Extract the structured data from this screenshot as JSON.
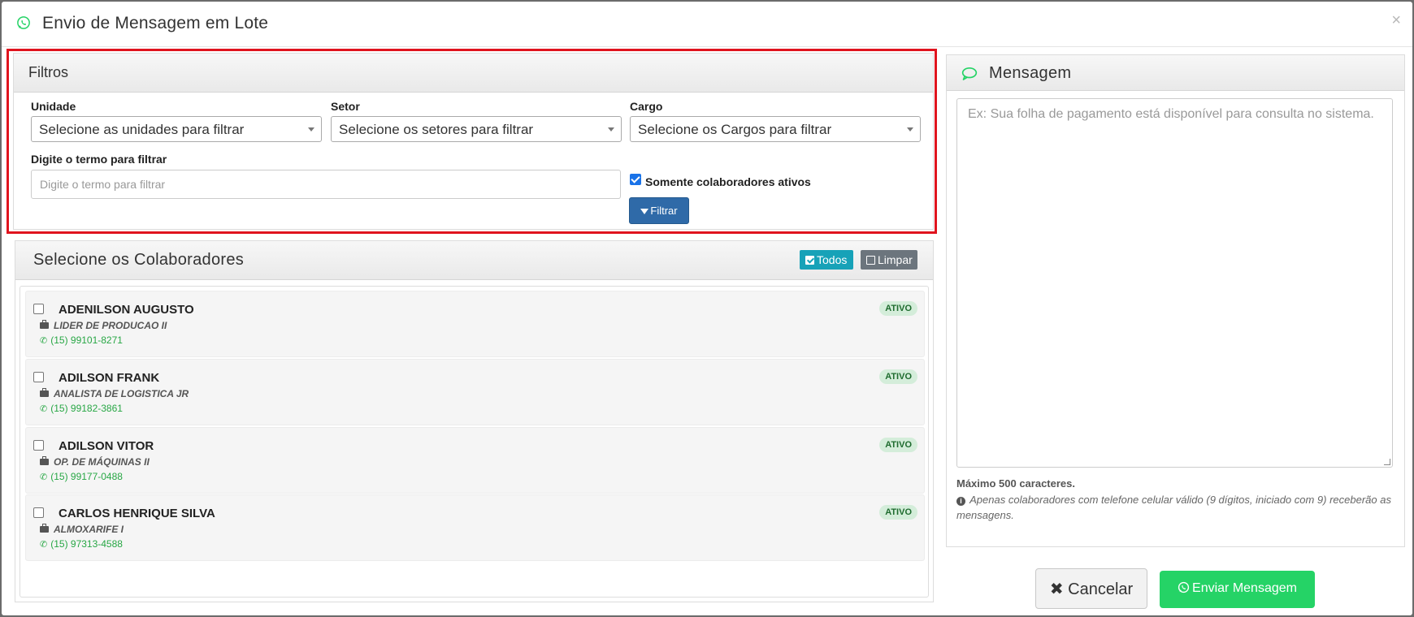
{
  "modal": {
    "title": "Envio de Mensagem em Lote",
    "close_label": "×"
  },
  "filters": {
    "title": "Filtros",
    "unidade_label": "Unidade",
    "unidade_placeholder": "Selecione as unidades para filtrar",
    "setor_label": "Setor",
    "setor_placeholder": "Selecione os setores para filtrar",
    "cargo_label": "Cargo",
    "cargo_placeholder": "Selecione os Cargos para filtrar",
    "term_label": "Digite o termo para filtrar",
    "term_placeholder": "Digite o termo para filtrar",
    "term_value": "",
    "only_active_label": "Somente colaboradores ativos",
    "only_active_checked": true,
    "filter_button": "Filtrar"
  },
  "colaboradores": {
    "title": "Selecione os Colaboradores",
    "select_all_label": "Todos",
    "clear_label": "Limpar",
    "items": [
      {
        "name": "ADENILSON AUGUSTO",
        "role": "LIDER DE PRODUCAO II",
        "phone": "(15) 99101-8271",
        "status": "ATIVO",
        "checked": false
      },
      {
        "name": "ADILSON FRANK",
        "role": "ANALISTA DE LOGISTICA JR",
        "phone": "(15) 99182-3861",
        "status": "ATIVO",
        "checked": false
      },
      {
        "name": "ADILSON VITOR",
        "role": "OP. DE MÁQUINAS II",
        "phone": "(15) 99177-0488",
        "status": "ATIVO",
        "checked": false
      },
      {
        "name": "CARLOS HENRIQUE SILVA",
        "role": "ALMOXARIFE I",
        "phone": "(15) 97313-4588",
        "status": "ATIVO",
        "checked": false
      }
    ]
  },
  "message": {
    "title": "Mensagem",
    "placeholder": "Ex: Sua folha de pagamento está disponível para consulta no sistema.",
    "value": "",
    "max_chars_note": "Máximo 500 caracteres.",
    "info_note": "Apenas colaboradores com telefone celular válido (9 dígitos, iniciado com 9) receberão as mensagens."
  },
  "footer": {
    "cancel_label": "Cancelar",
    "send_label": "Enviar Mensagem"
  },
  "colors": {
    "whatsapp_green": "#25d366",
    "filter_button": "#2f6aa8",
    "todos_button": "#17a2b8",
    "limpar_button": "#6c757d",
    "highlight_border": "#e0141e",
    "badge_bg": "#d4edda",
    "phone_text": "#28a745"
  },
  "icons": {
    "header": "whatsapp-icon",
    "close": "close-icon",
    "filter": "filter-icon",
    "message": "chat-bubble-icon",
    "role": "briefcase-icon",
    "phone": "phone-icon",
    "info": "info-icon",
    "cancel": "times-icon",
    "send": "whatsapp-icon"
  }
}
